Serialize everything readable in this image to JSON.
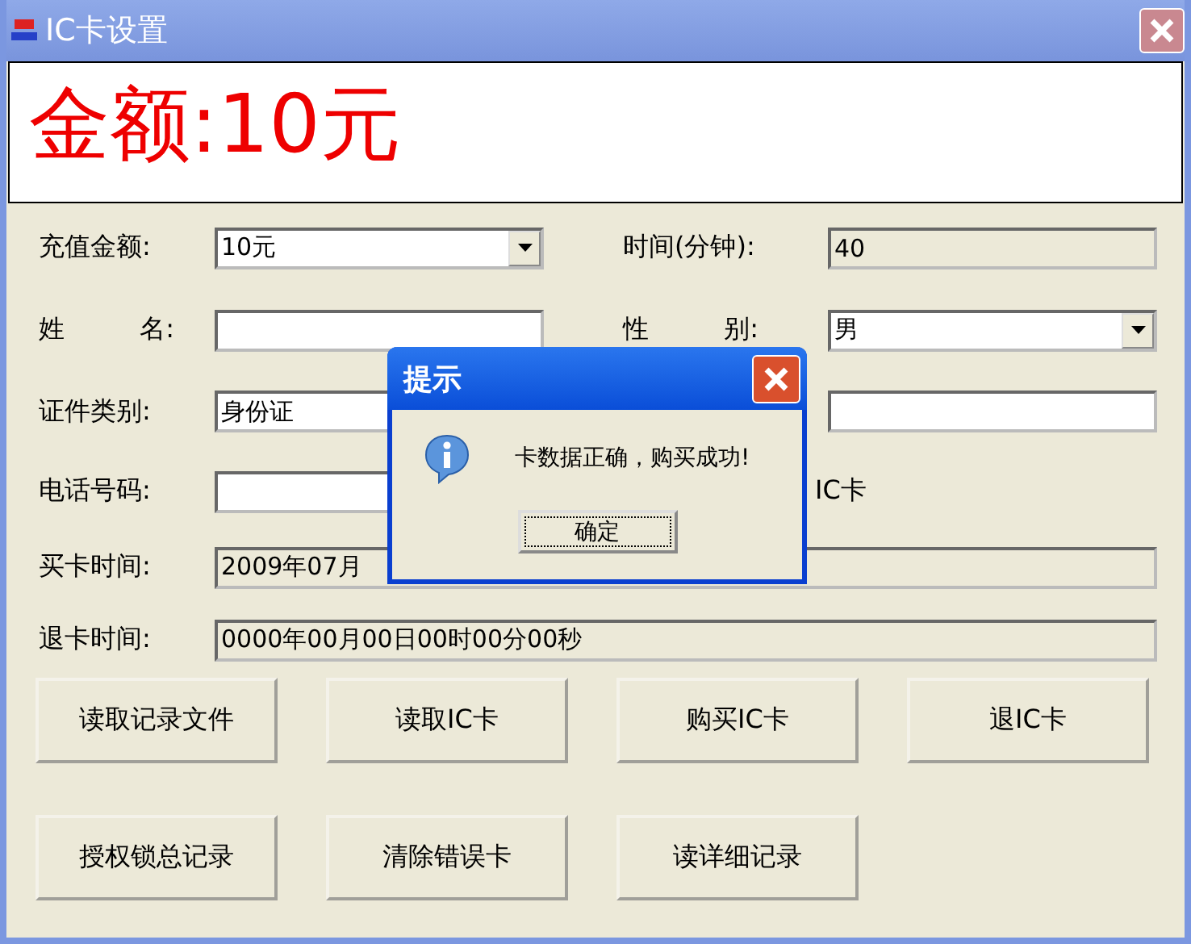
{
  "window": {
    "title": "IC卡设置"
  },
  "amount_display": "金额:10元",
  "fields": [
    {
      "label": "充值金额:",
      "kind": "combo",
      "value": "10元"
    },
    {
      "label": "时间(分钟):",
      "kind": "readonly",
      "value": "40"
    },
    {
      "label": "姓 名:",
      "kind": "text"
    },
    {
      "label": "性 别:",
      "kind": "combo",
      "value": "男"
    },
    {
      "label": "证件类别:",
      "kind": "text",
      "value": "身份证"
    },
    {
      "kind": "text"
    },
    {
      "label": "电话号码:",
      "kind": "text"
    },
    {
      "kind": "note",
      "value": "IC卡"
    },
    {
      "label": "买卡时间:",
      "kind": "readonly",
      "value": "2009年07月",
      "wide": true
    },
    {
      "label": "退卡时间:",
      "kind": "readonly",
      "value": "0000年00月00日00时00分00秒",
      "wide": true
    }
  ],
  "buttons": [
    "读取记录文件",
    "读取IC卡",
    "购买IC卡",
    "退IC卡",
    "授权锁总记录",
    "清除错误卡",
    "读详细记录"
  ],
  "dialog": {
    "title": "提示",
    "message": "卡数据正确，购买成功!",
    "button": "确定"
  }
}
